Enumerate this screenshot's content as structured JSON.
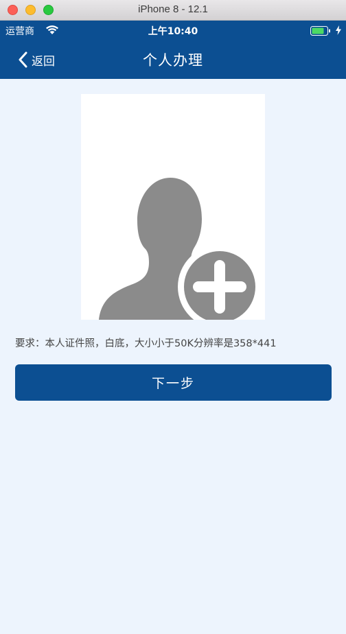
{
  "window": {
    "title": "iPhone 8 - 12.1"
  },
  "status_bar": {
    "carrier": "运营商",
    "time": "上午10:40"
  },
  "nav": {
    "back_label": "返回",
    "title": "个人办理"
  },
  "photo_upload": {
    "icon": "person-add-icon"
  },
  "requirement": {
    "text": "要求：本人证件照，白底，大小小于50K分辨率是358*441"
  },
  "next_button": {
    "label": "下一步"
  },
  "colors": {
    "primary": "#0c4f92",
    "background": "#edf4fd",
    "placeholder_gray": "#8b8b8b"
  }
}
